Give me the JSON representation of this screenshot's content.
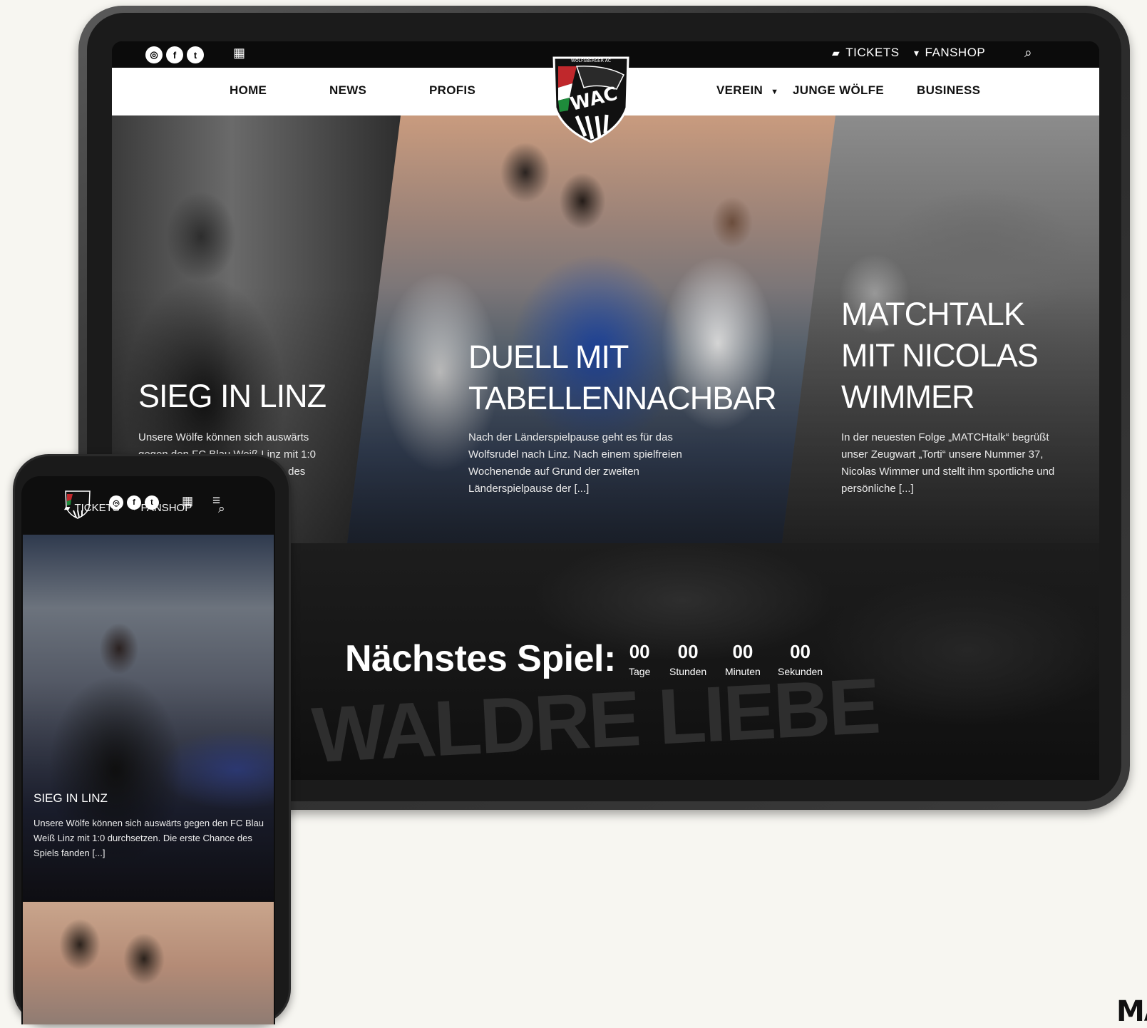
{
  "topbar": {
    "social": [
      "instagram-icon",
      "facebook-icon",
      "twitter-icon"
    ],
    "tickets_label": "TICKETS",
    "fanshop_label": "FANSHOP"
  },
  "nav": {
    "items": [
      "HOME",
      "NEWS",
      "PROFIS",
      "VEREIN",
      "JUNGE WÖLFE",
      "BUSINESS"
    ],
    "logo_top_text": "WOLFSBERGER AC",
    "logo_text": "WAC"
  },
  "hero": [
    {
      "title": "SIEG IN LINZ",
      "text": "Unsere Wölfe können sich auswärts gegen den FC Blau Weiß Linz mit 1:0 durchsetzen. Die erste Chance des"
    },
    {
      "title": "DUELL MIT TABELLENNACHBAR",
      "text": "Nach der Länderspielpause geht es für das Wolfsrudel nach Linz. Nach einem spielfreien Wochenende auf Grund der zweiten Länderspielpause der [...]"
    },
    {
      "title": "MATCHTALK MIT NICOLAS WIMMER",
      "text": "In der neuesten Folge „MATCHtalk“ begrüßt unser Zeugwart „Torti“ unsere Nummer 37, Nicolas Wimmer und stellt ihm sportliche und persönliche [...]"
    }
  ],
  "countdown": {
    "title": "Nächstes Spiel:",
    "items": [
      {
        "value": "00",
        "label": "Tage"
      },
      {
        "value": "00",
        "label": "Stunden"
      },
      {
        "value": "00",
        "label": "Minuten"
      },
      {
        "value": "00",
        "label": "Sekunden"
      }
    ],
    "background_text": "WALDRE LIEBE"
  },
  "phone": {
    "tickets_label": "TICKETS",
    "fanshop_label": "FANSHOP",
    "hero_title": "SIEG IN LINZ",
    "hero_text": "Unsere Wölfe können sich auswärts gegen den FC Blau Weiß Linz mit 1:0 durchsetzen. Die erste Chance des Spiels fanden [...]"
  },
  "brand_mark": "MA",
  "colors": {
    "nav_bg": "#ffffff",
    "topbar_bg": "#0b0b0b",
    "page_bg": "#f7f6f1"
  }
}
